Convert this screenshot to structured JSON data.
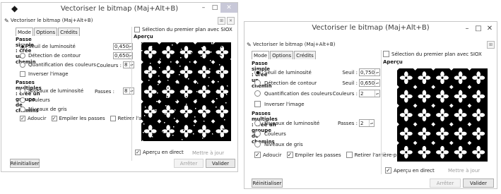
{
  "dialog": {
    "title": "Vectoriser le bitmap (Maj+Alt+B)",
    "subtitle": "Vectoriser le bitmap (Maj+Alt+B)",
    "tabs": [
      "Mode",
      "Options",
      "Crédits"
    ],
    "section_simple": "Passe simple : crée un chemin",
    "radio_seuil": "Seuil de luminosité",
    "seuil_label": "Seuil :",
    "seuil_value": "0,450",
    "radio_detection": "Détection de contour",
    "detection_label": "Seuil :",
    "detection_value": "0,650",
    "radio_quantif": "Quantification des couleurs",
    "couleurs_label": "Couleurs :",
    "couleurs_value": "8",
    "inverser": "Inverser l'image",
    "section_multi": "Passes multiples : crée un groupe de chemins",
    "radio_niveaux": "Niveaux de luminosité",
    "passes_label": "Passes :",
    "passes_value": "8",
    "radio_couleurs": "Couleurs",
    "radio_gris": "Niveaux de gris",
    "adoucir": "Adoucir",
    "empiler": "Empiler les passes",
    "retirer": "Retirer l'arrière-plan",
    "siox": "Sélection du premier plan avec SIOX",
    "apercu": "Aperçu",
    "apercu_direct": "Aperçu en direct",
    "mettre_a_jour": "Mettre à jour",
    "reinitialiser": "Réinitialiser",
    "arreter": "Arrêter",
    "valider": "Valider"
  },
  "left_values": {
    "seuil": "0,450",
    "detection": "0,650",
    "couleurs": "8",
    "passes": "8"
  },
  "right_values": {
    "seuil": "0,750",
    "detection": "0,650",
    "couleurs": "2",
    "passes": "2"
  },
  "window_controls": [
    "–",
    "□",
    "✕"
  ],
  "dock_controls": [
    "⊞",
    "✕"
  ],
  "colors": {
    "close": "#c8c8d8",
    "pattern": "#000000"
  }
}
